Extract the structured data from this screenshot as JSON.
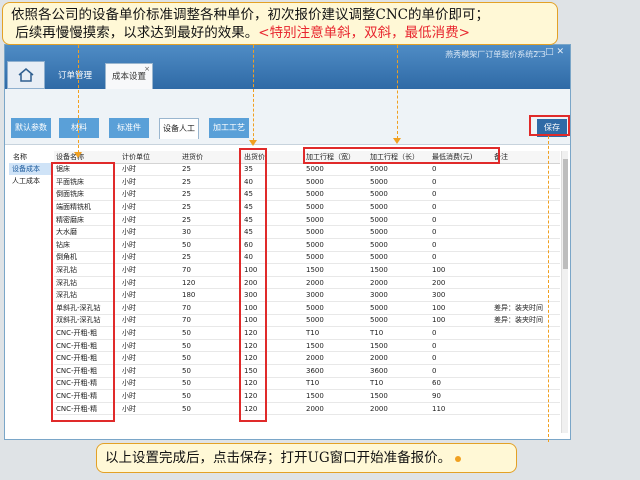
{
  "callout_top": {
    "line1": "依照各公司的设备单价标准调整各种单价，初次报价建议调整CNC的单价即可；",
    "line2_prefix": "后续再慢慢摸索，以求达到最好的效果。",
    "line2_red": "<特别注意单斜，双斜，最低消费>"
  },
  "callout_bottom": {
    "text": "以上设置完成后，点击保存；打开UG窗口开始准备报价。"
  },
  "app": {
    "title": "燕秀模架厂订单报价系统2.3",
    "window_controls": "— □ ✕",
    "main_tabs": [
      {
        "label": "订单管理"
      },
      {
        "label": "成本设置"
      }
    ],
    "close_tab_glyph": "×",
    "sub_tabs": [
      {
        "label": "默认参数"
      },
      {
        "label": "材料"
      },
      {
        "label": "标准件"
      },
      {
        "label": "设备人工"
      },
      {
        "label": "加工工艺"
      }
    ],
    "save_label": "保存"
  },
  "left_list": {
    "header": "名称",
    "items": [
      "设备成本",
      "人工成本"
    ]
  },
  "grid": {
    "headers": [
      "设备名称",
      "计价单位",
      "进货价",
      "出货价",
      "加工行程（宽）",
      "加工行程（长）",
      "最低消费(元)",
      "备注"
    ],
    "rows": [
      [
        "锯床",
        "小时",
        "25",
        "35",
        "5000",
        "5000",
        "0",
        ""
      ],
      [
        "平面铣床",
        "小时",
        "25",
        "40",
        "5000",
        "5000",
        "0",
        ""
      ],
      [
        "倒面铣床",
        "小时",
        "25",
        "45",
        "5000",
        "5000",
        "0",
        ""
      ],
      [
        "端面精铣机",
        "小时",
        "25",
        "45",
        "5000",
        "5000",
        "0",
        ""
      ],
      [
        "精密磨床",
        "小时",
        "25",
        "45",
        "5000",
        "5000",
        "0",
        ""
      ],
      [
        "大水磨",
        "小时",
        "30",
        "45",
        "5000",
        "5000",
        "0",
        ""
      ],
      [
        "钻床",
        "小时",
        "50",
        "60",
        "5000",
        "5000",
        "0",
        ""
      ],
      [
        "倒角机",
        "小时",
        "25",
        "40",
        "5000",
        "5000",
        "0",
        ""
      ],
      [
        "深孔钻",
        "小时",
        "70",
        "100",
        "1500",
        "1500",
        "100",
        ""
      ],
      [
        "深孔钻",
        "小时",
        "120",
        "200",
        "2000",
        "2000",
        "200",
        ""
      ],
      [
        "深孔钻",
        "小时",
        "180",
        "300",
        "3000",
        "3000",
        "300",
        ""
      ],
      [
        "单斜孔-深孔钻",
        "小时",
        "70",
        "100",
        "5000",
        "5000",
        "100",
        "差异：装夹时间"
      ],
      [
        "双斜孔-深孔钻",
        "小时",
        "70",
        "100",
        "5000",
        "5000",
        "100",
        "差异：装夹时间"
      ],
      [
        "CNC-开粗-粗",
        "小时",
        "50",
        "120",
        "T10",
        "T10",
        "0",
        ""
      ],
      [
        "CNC-开粗-粗",
        "小时",
        "50",
        "120",
        "1500",
        "1500",
        "0",
        ""
      ],
      [
        "CNC-开粗-粗",
        "小时",
        "50",
        "120",
        "2000",
        "2000",
        "0",
        ""
      ],
      [
        "CNC-开粗-粗",
        "小时",
        "50",
        "150",
        "3600",
        "3600",
        "0",
        ""
      ],
      [
        "CNC-开粗-精",
        "小时",
        "50",
        "120",
        "T10",
        "T10",
        "60",
        ""
      ],
      [
        "CNC-开粗-精",
        "小时",
        "50",
        "120",
        "1500",
        "1500",
        "90",
        ""
      ],
      [
        "CNC-开粗-精",
        "小时",
        "50",
        "120",
        "2000",
        "2000",
        "110",
        ""
      ]
    ]
  },
  "colors": {
    "highlight": "#e02a2a",
    "callout_border": "#e3a126",
    "arrow": "#f0a020",
    "title_bar": "#2f6aa6",
    "red_text": "#e8262f"
  }
}
